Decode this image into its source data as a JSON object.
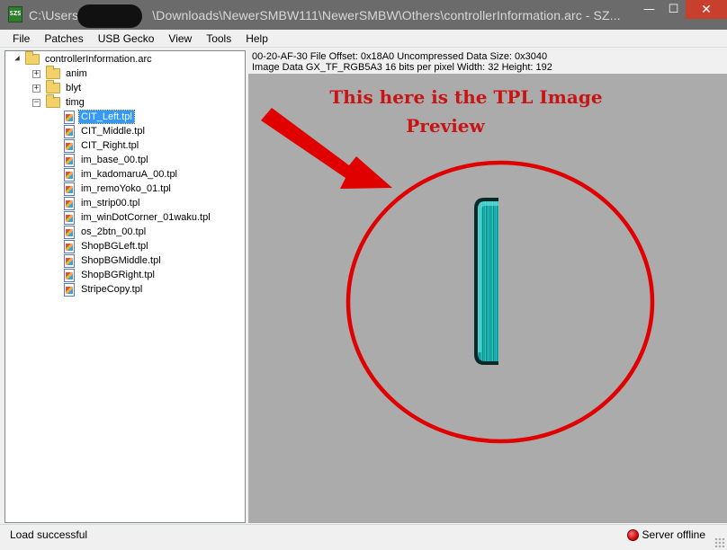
{
  "window": {
    "title_prefix": "C:\\Users\\",
    "title_suffix": "\\Downloads\\NewerSMBW111\\NewerSMBW\\Others\\controllerInformation.arc - SZ...",
    "app_icon_text": "SZS",
    "controls": {
      "minimize": "—",
      "maximize": "☐",
      "close": "✕"
    }
  },
  "menu": [
    "File",
    "Patches",
    "USB Gecko",
    "View",
    "Tools",
    "Help"
  ],
  "tree": {
    "root": "controllerInformation.arc",
    "folders": [
      {
        "label": "anim",
        "expander": "+"
      },
      {
        "label": "blyt",
        "expander": "+"
      },
      {
        "label": "timg",
        "expander": "−"
      }
    ],
    "files": [
      "CIT_Left.tpl",
      "CIT_Middle.tpl",
      "CIT_Right.tpl",
      "im_base_00.tpl",
      "im_kadomaruA_00.tpl",
      "im_remoYoko_01.tpl",
      "im_strip00.tpl",
      "im_winDotCorner_01waku.tpl",
      "os_2btn_00.tpl",
      "ShopBGLeft.tpl",
      "ShopBGMiddle.tpl",
      "ShopBGRight.tpl",
      "StripeCopy.tpl"
    ],
    "selected_file": "CIT_Left.tpl"
  },
  "info": {
    "line1": "00-20-AF-30 File Offset: 0x18A0 Uncompressed Data Size: 0x3040",
    "line2": "Image Data GX_TF_RGB5A3 16 bits per pixel Width: 32 Height: 192"
  },
  "annotation": {
    "line1": "This here is the TPL Image",
    "line2": "Preview",
    "color": "#e00000"
  },
  "status": {
    "left": "Load successful",
    "right": "Server offline"
  },
  "colors": {
    "preview_bg": "#ababab",
    "tile_teal": "#1fb3b0",
    "selection": "#3399ff"
  }
}
